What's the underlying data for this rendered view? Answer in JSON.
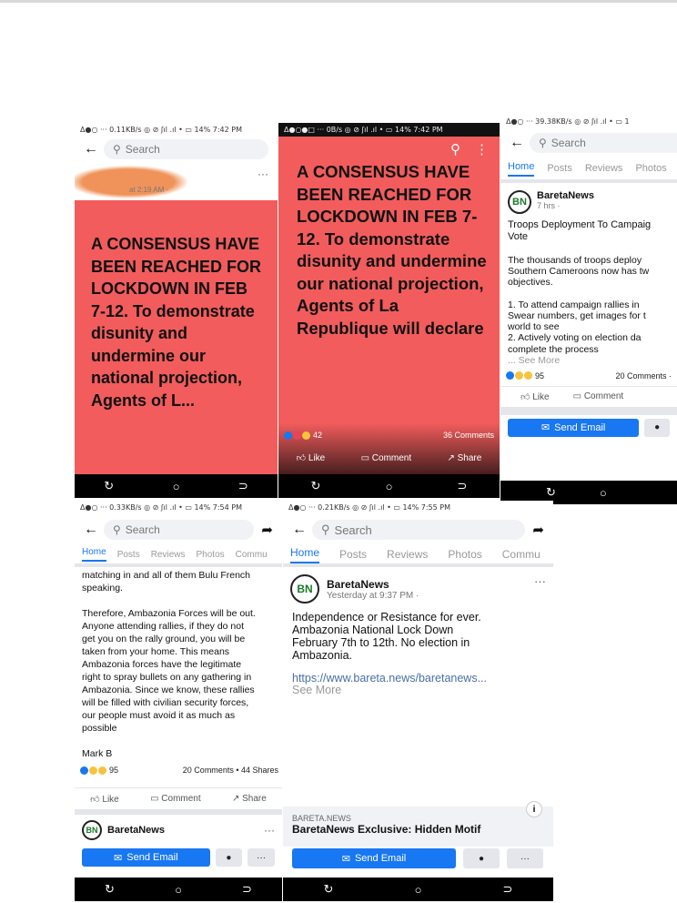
{
  "s1": {
    "status": "Δ●○ ···  0.11KB/s ◎ ⊘ ʃıl .ıl • ▭ 14% 7:42 PM",
    "search_placeholder": "Search",
    "post_meta": "at 2:19 AM ·",
    "post_text": "A CONSENSUS HAVE BEEN REACHED FOR LOCKDOWN IN FEB 7-12. To demonstrate disunity and undermine our national projection, Agents of L..."
  },
  "s2": {
    "status": "Δ●○●□ ···  0B/s ◎ ⊘ ʃıl .ıl • ▭ 14% 7:42 PM",
    "post_text": "A CONSENSUS HAVE BEEN REACHED FOR LOCKDOWN IN FEB 7-12. To demonstrate disunity and undermine our national projection, Agents of La Republique will declare",
    "reactions": "42",
    "comments": "36 Comments",
    "like": "Like",
    "comment": "Comment",
    "share": "Share"
  },
  "s3": {
    "status": "Δ●○ ···  39.38KB/s ◎ ⊘ ʃıl .ıl • ▭ 1",
    "search_placeholder": "Search",
    "tabs": [
      "Home",
      "Posts",
      "Reviews",
      "Photos"
    ],
    "page_name": "BaretaNews",
    "post_time": "7 hrs ·",
    "post_title": "Troops Deployment To Campaig\nVote",
    "post_body": "The thousands of troops deploy\nSouthern Cameroons now has tw\nobjectives.\n\n1. To attend campaign rallies in\nSwear numbers, get images for t\nworld to see\n2. Actively voting on election da\ncomplete the process",
    "see_more": "... See More",
    "reactions": "95",
    "comments": "20 Comments ·",
    "like": "Like",
    "comment": "Comment",
    "send_email": "Send Email"
  },
  "s4": {
    "status": "Δ●○ ···  0.33KB/s ◎ ⊘ ʃıl .ıl • ▭ 14% 7:54 PM",
    "search_placeholder": "Search",
    "tabs": [
      "Home",
      "Posts",
      "Reviews",
      "Photos",
      "Commu"
    ],
    "body": "matching in and all of them Bulu French\nspeaking.\n\nTherefore, Ambazonia Forces will be out.\nAnyone attending rallies, if they do not\nget you on the rally ground, you will be\ntaken from your home. This means\nAmbazonia forces have the legitimate\nright to spray bullets on any gathering in\nAmbazonia. Since we know, these rallies\nwill be filled with civilian security forces,\nour people must avoid it as much as\npossible\n\nMark B",
    "reactions": "95",
    "comments_shares": "20 Comments • 44 Shares",
    "like": "Like",
    "comment": "Comment",
    "share": "Share",
    "page_name": "BaretaNews",
    "send_email": "Send Email"
  },
  "s5": {
    "status": "Δ●○ ···  0.21KB/s ◎ ⊘ ʃıl .ıl • ▭ 14% 7:55 PM",
    "search_placeholder": "Search",
    "tabs": [
      "Home",
      "Posts",
      "Reviews",
      "Photos",
      "Commu"
    ],
    "page_name": "BaretaNews",
    "post_time": "Yesterday at 9:37 PM ·",
    "post_text": "Independence or Resistance for ever.\nAmbazonia National Lock Down\nFebruary 7th to 12th. No election in\nAmbazonia.",
    "link": "https://www.bareta.news/baretanews...",
    "see_more": "See More",
    "link_domain": "BARETA.NEWS",
    "link_title": "BaretaNews Exclusive: Hidden Motif",
    "send_email": "Send Email"
  }
}
